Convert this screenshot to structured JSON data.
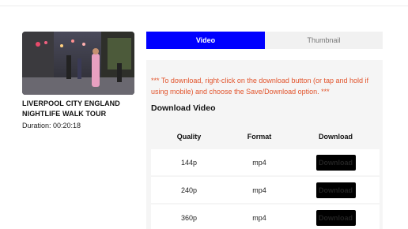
{
  "video": {
    "title": "LIVERPOOL CITY ENGLAND NIGHTLIFE WALK TOUR",
    "duration": "Duration: 00:20:18"
  },
  "tabs": [
    {
      "label": "Video",
      "active": true
    },
    {
      "label": "Thumbnail",
      "active": false
    }
  ],
  "notice": "*** To download, right-click on the download button (or tap and hold if using mobile) and choose the Save/Download option. ***",
  "section_title": "Download Video",
  "table": {
    "headers": {
      "quality": "Quality",
      "format": "Format",
      "download": "Download"
    },
    "rows": [
      {
        "quality": "144p",
        "format": "mp4",
        "button": "Download"
      },
      {
        "quality": "240p",
        "format": "mp4",
        "button": "Download"
      },
      {
        "quality": "360p",
        "format": "mp4",
        "button": "Download"
      }
    ]
  },
  "colors": {
    "accent": "#0000ff",
    "notice": "#e2542c",
    "button": "#000000"
  }
}
